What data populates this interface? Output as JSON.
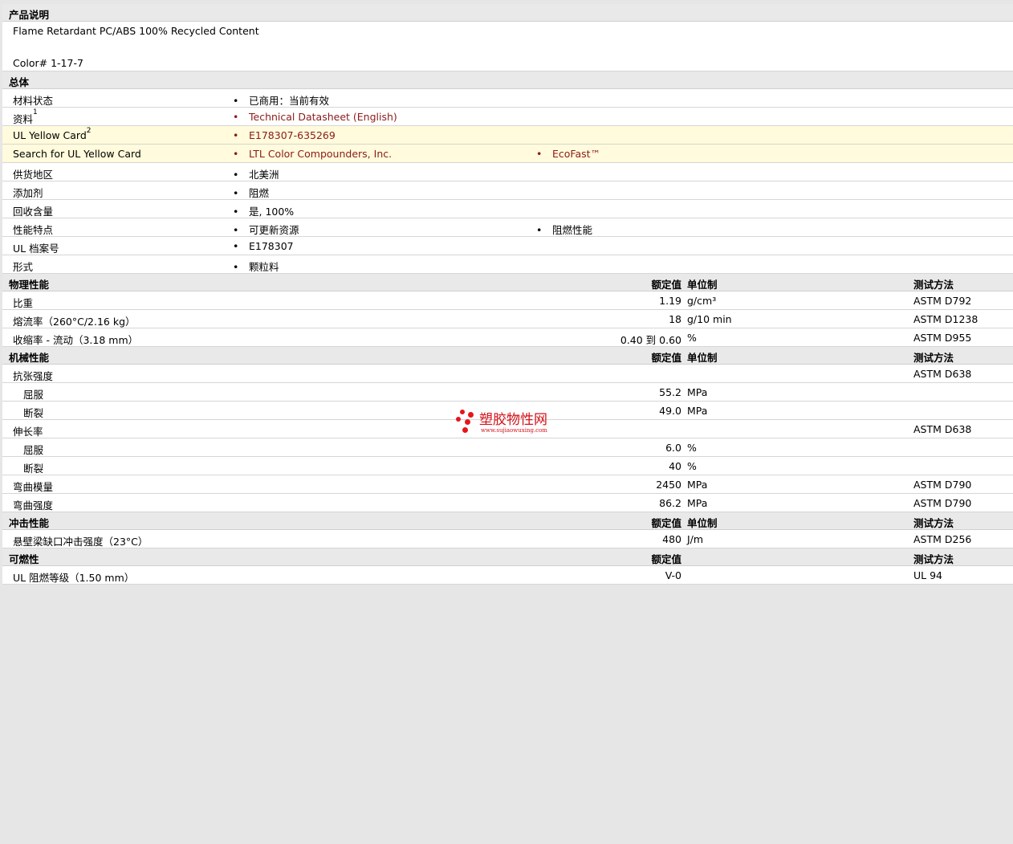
{
  "description": {
    "title": "产品说明",
    "line1": "Flame Retardant PC/ABS 100% Recycled Content",
    "line2": "Color# 1-17-7"
  },
  "general": {
    "title": "总体",
    "material_status": {
      "label": "材料状态",
      "value": "已商用：当前有效"
    },
    "documents": {
      "label": "资料",
      "sup": "1",
      "value": "Technical Datasheet (English)"
    },
    "ul_yellow_card": {
      "label": "UL Yellow Card",
      "sup": "2",
      "value": "E178307-635269"
    },
    "search_ul": {
      "label": "Search for UL Yellow Card",
      "value1": "LTL Color Compounders, Inc.",
      "value2": "EcoFast™"
    },
    "supply_region": {
      "label": "供货地区",
      "value": "北美洲"
    },
    "additive": {
      "label": "添加剂",
      "value": "阻燃"
    },
    "recycled": {
      "label": "回收含量",
      "value": "是, 100%"
    },
    "features": {
      "label": "性能特点",
      "value1": "可更新资源",
      "value2": "阻燃性能"
    },
    "ul_file": {
      "label": "UL 档案号",
      "value": "E178307"
    },
    "form": {
      "label": "形式",
      "value": "颗粒料"
    }
  },
  "headers": {
    "nominal": "额定值",
    "unit": "单位制",
    "method": "测试方法"
  },
  "physical": {
    "title": "物理性能",
    "rows": [
      {
        "label": "比重",
        "value": "1.19",
        "unit": "g/cm³",
        "method": "ASTM D792"
      },
      {
        "label": "熔流率（260°C/2.16 kg）",
        "value": "18",
        "unit": "g/10 min",
        "method": "ASTM D1238"
      },
      {
        "label": "收缩率 - 流动（3.18 mm）",
        "value": "0.40 到  0.60",
        "unit": "%",
        "method": "ASTM D955"
      }
    ]
  },
  "mechanical": {
    "title": "机械性能",
    "rows": [
      {
        "label": "抗张强度",
        "value": "",
        "unit": "",
        "method": "ASTM D638"
      },
      {
        "label": "屈服",
        "value": "55.2",
        "unit": "MPa",
        "method": ""
      },
      {
        "label": "断裂",
        "value": "49.0",
        "unit": "MPa",
        "method": ""
      },
      {
        "label": "伸长率",
        "value": "",
        "unit": "",
        "method": "ASTM D638"
      },
      {
        "label": "屈服",
        "value": "6.0",
        "unit": "%",
        "method": ""
      },
      {
        "label": "断裂",
        "value": "40",
        "unit": "%",
        "method": ""
      },
      {
        "label": "弯曲模量",
        "value": "2450",
        "unit": "MPa",
        "method": "ASTM D790"
      },
      {
        "label": "弯曲强度",
        "value": "86.2",
        "unit": "MPa",
        "method": "ASTM D790"
      }
    ]
  },
  "impact": {
    "title": "冲击性能",
    "rows": [
      {
        "label": "悬壁梁缺口冲击强度（23°C）",
        "value": "480",
        "unit": "J/m",
        "method": "ASTM D256"
      }
    ]
  },
  "flammability": {
    "title": "可燃性",
    "rows": [
      {
        "label": "UL 阻燃等级（1.50 mm）",
        "value": "V-0",
        "method": "UL 94"
      }
    ]
  },
  "watermark": {
    "name": "塑胶物性网",
    "url": "www.sujiaowuxing.com"
  }
}
